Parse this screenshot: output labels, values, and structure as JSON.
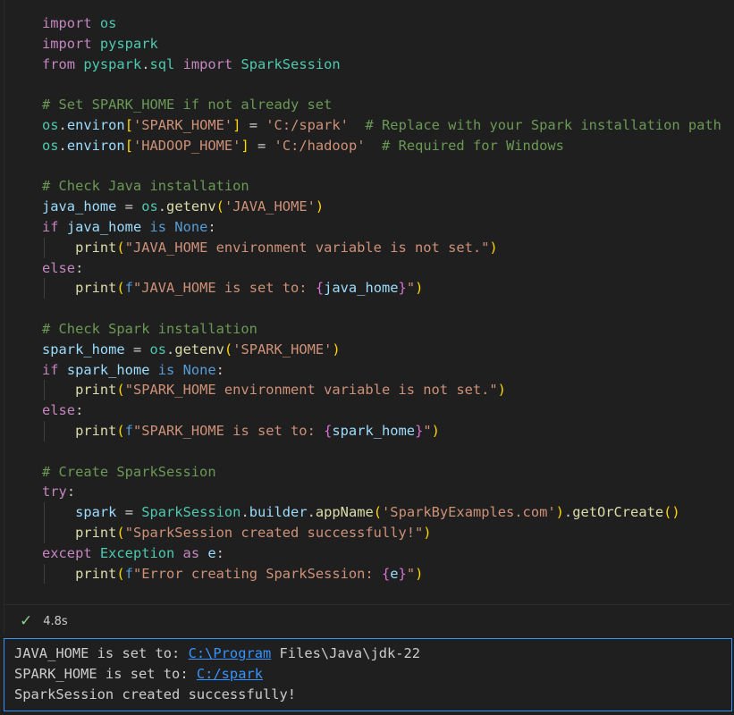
{
  "code_lines": [
    [
      [
        "kw",
        "import "
      ],
      [
        "mod",
        "os"
      ]
    ],
    [
      [
        "kw",
        "import "
      ],
      [
        "mod",
        "pyspark"
      ]
    ],
    [
      [
        "kw",
        "from "
      ],
      [
        "mod",
        "pyspark"
      ],
      [
        "",
        "."
      ],
      [
        "mod",
        "sql"
      ],
      [
        "kw",
        " import "
      ],
      [
        "mod",
        "SparkSession"
      ]
    ],
    [],
    [
      [
        "cmt",
        "# Set SPARK_HOME if not already set"
      ]
    ],
    [
      [
        "mod",
        "os"
      ],
      [
        "",
        "."
      ],
      [
        "var",
        "environ"
      ],
      [
        "br1",
        "["
      ],
      [
        "str",
        "'SPARK_HOME'"
      ],
      [
        "br1",
        "]"
      ],
      [
        "",
        " = "
      ],
      [
        "str",
        "'C:/spark'"
      ],
      [
        "",
        "  "
      ],
      [
        "cmt",
        "# Replace with your Spark installation path"
      ]
    ],
    [
      [
        "mod",
        "os"
      ],
      [
        "",
        "."
      ],
      [
        "var",
        "environ"
      ],
      [
        "br1",
        "["
      ],
      [
        "str",
        "'HADOOP_HOME'"
      ],
      [
        "br1",
        "]"
      ],
      [
        "",
        " = "
      ],
      [
        "str",
        "'C:/hadoop'"
      ],
      [
        "",
        "  "
      ],
      [
        "cmt",
        "# Required for Windows"
      ]
    ],
    [],
    [
      [
        "cmt",
        "# Check Java installation"
      ]
    ],
    [
      [
        "var",
        "java_home"
      ],
      [
        "",
        " = "
      ],
      [
        "mod",
        "os"
      ],
      [
        "",
        "."
      ],
      [
        "fn",
        "getenv"
      ],
      [
        "br1",
        "("
      ],
      [
        "str",
        "'JAVA_HOME'"
      ],
      [
        "br1",
        ")"
      ]
    ],
    [
      [
        "kw",
        "if "
      ],
      [
        "var",
        "java_home"
      ],
      [
        "kw2",
        " is "
      ],
      [
        "kw2",
        "None"
      ],
      [
        "",
        ":"
      ]
    ],
    [
      [
        "",
        "    "
      ],
      [
        "fn",
        "print"
      ],
      [
        "br1",
        "("
      ],
      [
        "str",
        "\"JAVA_HOME environment variable is not set.\""
      ],
      [
        "br1",
        ")"
      ]
    ],
    [
      [
        "kw",
        "else"
      ],
      [
        "",
        ":"
      ]
    ],
    [
      [
        "",
        "    "
      ],
      [
        "fn",
        "print"
      ],
      [
        "br1",
        "("
      ],
      [
        "kw2",
        "f"
      ],
      [
        "str",
        "\"JAVA_HOME is set to: "
      ],
      [
        "br2",
        "{"
      ],
      [
        "var",
        "java_home"
      ],
      [
        "br2",
        "}"
      ],
      [
        "str",
        "\""
      ],
      [
        "br1",
        ")"
      ]
    ],
    [],
    [
      [
        "cmt",
        "# Check Spark installation"
      ]
    ],
    [
      [
        "var",
        "spark_home"
      ],
      [
        "",
        " = "
      ],
      [
        "mod",
        "os"
      ],
      [
        "",
        "."
      ],
      [
        "fn",
        "getenv"
      ],
      [
        "br1",
        "("
      ],
      [
        "str",
        "'SPARK_HOME'"
      ],
      [
        "br1",
        ")"
      ]
    ],
    [
      [
        "kw",
        "if "
      ],
      [
        "var",
        "spark_home"
      ],
      [
        "kw2",
        " is "
      ],
      [
        "kw2",
        "None"
      ],
      [
        "",
        ":"
      ]
    ],
    [
      [
        "",
        "    "
      ],
      [
        "fn",
        "print"
      ],
      [
        "br1",
        "("
      ],
      [
        "str",
        "\"SPARK_HOME environment variable is not set.\""
      ],
      [
        "br1",
        ")"
      ]
    ],
    [
      [
        "kw",
        "else"
      ],
      [
        "",
        ":"
      ]
    ],
    [
      [
        "",
        "    "
      ],
      [
        "fn",
        "print"
      ],
      [
        "br1",
        "("
      ],
      [
        "kw2",
        "f"
      ],
      [
        "str",
        "\"SPARK_HOME is set to: "
      ],
      [
        "br2",
        "{"
      ],
      [
        "var",
        "spark_home"
      ],
      [
        "br2",
        "}"
      ],
      [
        "str",
        "\""
      ],
      [
        "br1",
        ")"
      ]
    ],
    [],
    [
      [
        "cmt",
        "# Create SparkSession"
      ]
    ],
    [
      [
        "kw",
        "try"
      ],
      [
        "",
        ":"
      ]
    ],
    [
      [
        "",
        "    "
      ],
      [
        "var",
        "spark"
      ],
      [
        "",
        " = "
      ],
      [
        "mod",
        "SparkSession"
      ],
      [
        "",
        "."
      ],
      [
        "var",
        "builder"
      ],
      [
        "",
        "."
      ],
      [
        "fn",
        "appName"
      ],
      [
        "br1",
        "("
      ],
      [
        "str",
        "'SparkByExamples.com'"
      ],
      [
        "br1",
        ")"
      ],
      [
        "",
        "."
      ],
      [
        "fn",
        "getOrCreate"
      ],
      [
        "br1",
        "()"
      ]
    ],
    [
      [
        "",
        "    "
      ],
      [
        "fn",
        "print"
      ],
      [
        "br1",
        "("
      ],
      [
        "str",
        "\"SparkSession created successfully!\""
      ],
      [
        "br1",
        ")"
      ]
    ],
    [
      [
        "kw",
        "except "
      ],
      [
        "mod",
        "Exception"
      ],
      [
        "kw",
        " as "
      ],
      [
        "var",
        "e"
      ],
      [
        "",
        ":"
      ]
    ],
    [
      [
        "",
        "    "
      ],
      [
        "fn",
        "print"
      ],
      [
        "br1",
        "("
      ],
      [
        "kw2",
        "f"
      ],
      [
        "str",
        "\"Error creating SparkSession: "
      ],
      [
        "br2",
        "{"
      ],
      [
        "var",
        "e"
      ],
      [
        "br2",
        "}"
      ],
      [
        "str",
        "\""
      ],
      [
        "br1",
        ")"
      ]
    ]
  ],
  "status": {
    "check_icon": "✓",
    "duration": "4.8s",
    "success_color": "#89d185"
  },
  "output": {
    "line1_prefix": "JAVA_HOME is set to: ",
    "line1_link": "C:\\Program",
    "line1_suffix": " Files\\Java\\jdk-22",
    "line2_prefix": "SPARK_HOME is set to: ",
    "line2_link": "C:/spark",
    "line3": "SparkSession created successfully!"
  }
}
